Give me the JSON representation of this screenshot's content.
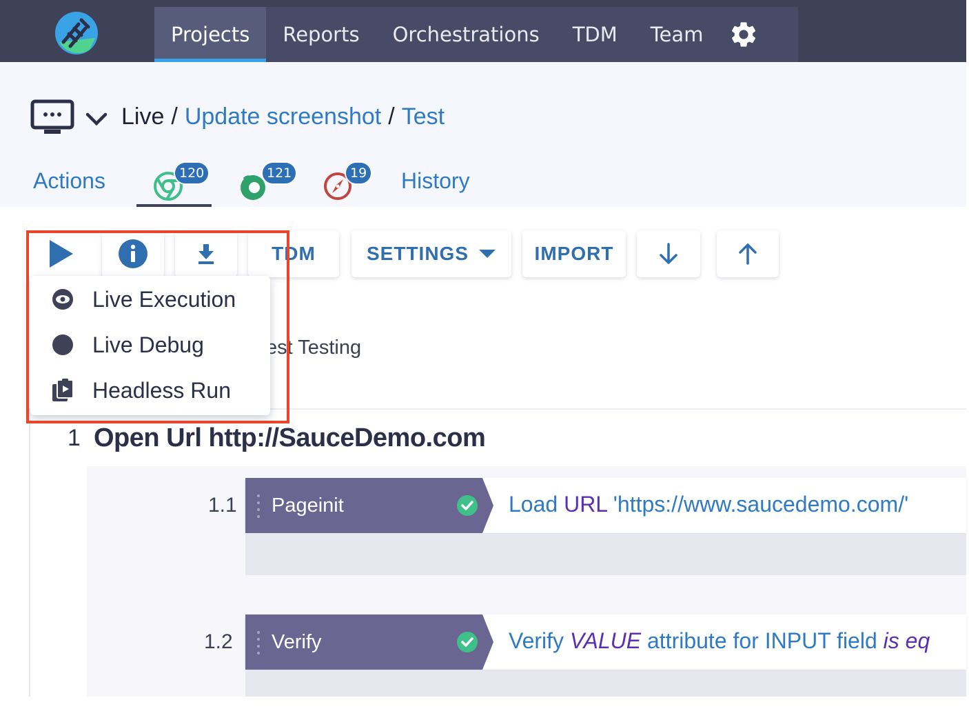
{
  "topnav": {
    "logo": "app-logo",
    "tabs": [
      {
        "label": "Projects",
        "active": true
      },
      {
        "label": "Reports",
        "active": false
      },
      {
        "label": "Orchestrations",
        "active": false
      },
      {
        "label": "TDM",
        "active": false
      },
      {
        "label": "Team",
        "active": false
      }
    ],
    "settings_icon": "gear-icon"
  },
  "breadcrumb": {
    "icon": "device-icon",
    "root": "Live",
    "separator": "/",
    "items": [
      "Update screenshot",
      "Test"
    ]
  },
  "subtabs": {
    "actions_label": "Actions",
    "history_label": "History",
    "browsers": [
      {
        "icon": "chrome-icon",
        "count": "120",
        "active": true
      },
      {
        "icon": "firefox-icon",
        "count": "121",
        "active": false
      },
      {
        "icon": "safari-icon",
        "count": "19",
        "active": false
      }
    ]
  },
  "toolbar": {
    "run_icon": "play-icon",
    "info_icon": "info-icon",
    "download_icon": "download-icon",
    "tdm_label": "TDM",
    "settings_label": "SETTINGS",
    "import_label": "IMPORT",
    "down_icon": "arrow-down-icon",
    "up_icon": "arrow-up-icon"
  },
  "run_menu": {
    "items": [
      {
        "label": "Live Execution",
        "icon": "eye-icon"
      },
      {
        "label": "Live Debug",
        "icon": "circle-icon"
      },
      {
        "label": "Headless Run",
        "icon": "clipboard-play-icon"
      }
    ]
  },
  "peek_text": "est Testing",
  "steps": [
    {
      "number": "1",
      "title": "Open Url http://SauceDemo.com",
      "substeps": [
        {
          "number": "1.1",
          "tag": "Pageinit",
          "status": "passed",
          "text_parts": [
            "Load ",
            "URL",
            "  'https://www.saucedemo.com/'"
          ]
        },
        {
          "number": "1.2",
          "tag": "Verify",
          "status": "passed",
          "text_parts": [
            "Verify ",
            "VALUE",
            "  attribute for INPUT  field ",
            "is eq"
          ]
        }
      ]
    }
  ],
  "colors": {
    "nav_bg": "#3f4159",
    "accent_blue": "#2f7ac5",
    "tag_purple": "#6b6592",
    "highlight_red": "#e8452b",
    "check_green": "#3fbf8a",
    "keyword_purple": "#5b2fb3"
  }
}
